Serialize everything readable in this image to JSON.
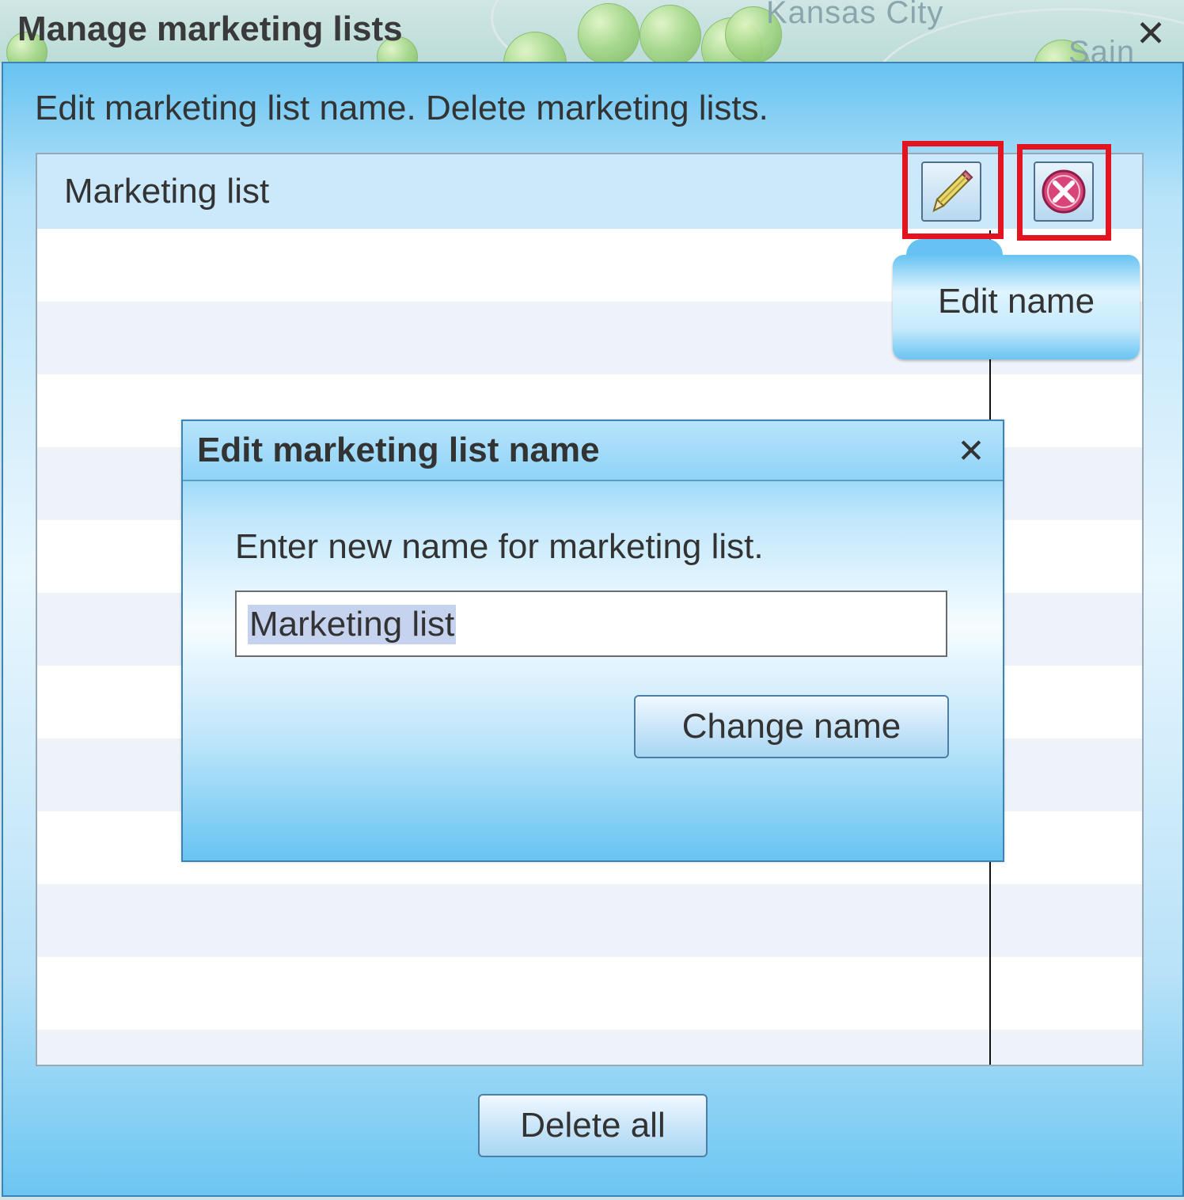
{
  "main_window": {
    "title": "Manage marketing lists",
    "close_glyph": "✕",
    "description": "Edit marketing list name. Delete marketing lists.",
    "list_header_label": "Marketing list",
    "delete_all_label": "Delete all",
    "map_label": "Kansas City",
    "map_label_partial": "Sain"
  },
  "tooltip": {
    "text": "Edit name"
  },
  "dialog": {
    "title": "Edit marketing list name",
    "close_glyph": "✕",
    "prompt": "Enter new name for marketing list.",
    "input_value": "Marketing list",
    "submit_label": "Change name"
  },
  "icons": {
    "edit": "pencil-icon",
    "delete": "delete-circle-icon"
  },
  "colors": {
    "highlight": "#e3141f",
    "accent": "#66c3f1"
  }
}
